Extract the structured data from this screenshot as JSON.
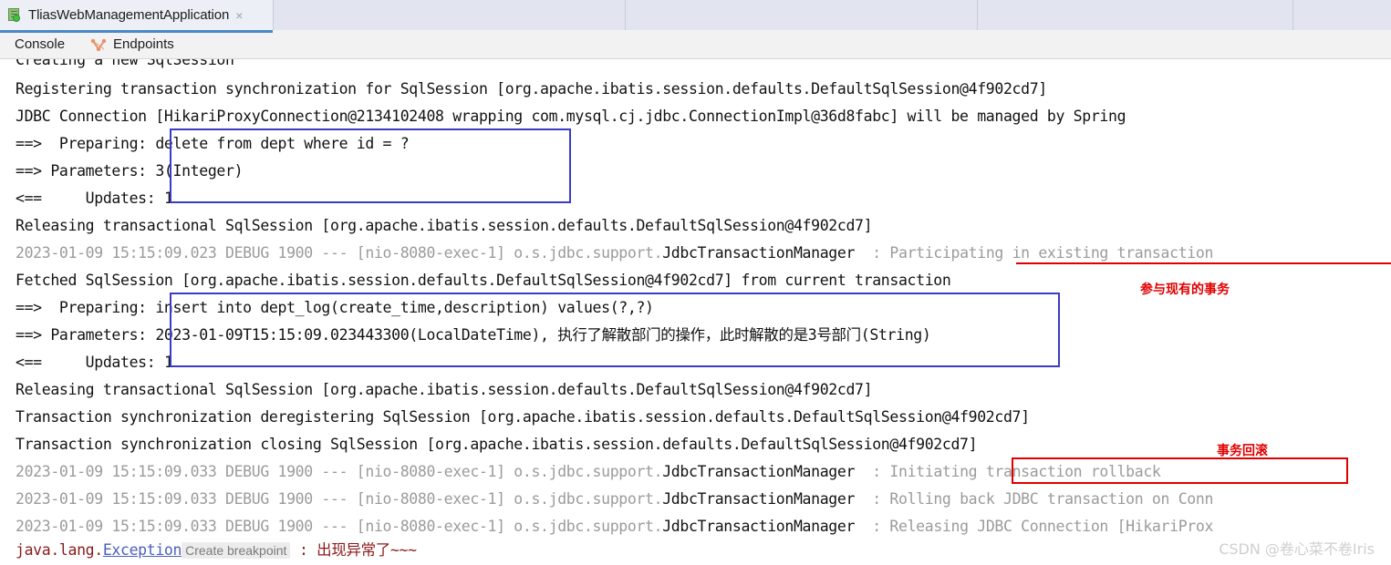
{
  "window": {
    "tab": {
      "icon": "run-configuration-icon",
      "title": "TliasWebManagementApplication",
      "close": "×"
    }
  },
  "console_bar": {
    "items": [
      {
        "label": "Console",
        "icon": "console-icon"
      },
      {
        "label": "Endpoints",
        "icon": "endpoints-icon"
      }
    ]
  },
  "console": {
    "clipped_line": "Creating a new SqlSession",
    "lines": [
      {
        "text": "Registering transaction synchronization for SqlSession [org.apache.ibatis.session.defaults.DefaultSqlSession@4f902cd7]",
        "style": "dark"
      },
      {
        "text": "JDBC Connection [HikariProxyConnection@2134102408 wrapping com.mysql.cj.jdbc.ConnectionImpl@36d8fabc] will be managed by Spring",
        "style": "dark"
      },
      {
        "text": "==>  Preparing: delete from dept where id = ?",
        "style": "dark"
      },
      {
        "text": "==> Parameters: 3(Integer)",
        "style": "dark"
      },
      {
        "text": "<==     Updates: 1",
        "style": "dark"
      },
      {
        "text": "Releasing transactional SqlSession [org.apache.ibatis.session.defaults.DefaultSqlSession@4f902cd7]",
        "style": "dark"
      },
      {
        "text": "2023-01-09 15:15:09.023 DEBUG 1900 --- [nio-8080-exec-1] o.s.jdbc.support.JdbcTransactionManager  : Participating in existing transaction",
        "style": "log"
      },
      {
        "text": "Fetched SqlSession [org.apache.ibatis.session.defaults.DefaultSqlSession@4f902cd7] from current transaction",
        "style": "dark"
      },
      {
        "text": "==>  Preparing: insert into dept_log(create_time,description) values(?,?)",
        "style": "dark"
      },
      {
        "text": "==> Parameters: 2023-01-09T15:15:09.023443300(LocalDateTime), 执行了解散部门的操作，此时解散的是3号部门(String)",
        "style": "dark"
      },
      {
        "text": "<==     Updates: 1",
        "style": "dark"
      },
      {
        "text": "Releasing transactional SqlSession [org.apache.ibatis.session.defaults.DefaultSqlSession@4f902cd7]",
        "style": "dark"
      },
      {
        "text": "Transaction synchronization deregistering SqlSession [org.apache.ibatis.session.defaults.DefaultSqlSession@4f902cd7]",
        "style": "dark"
      },
      {
        "text": "Transaction synchronization closing SqlSession [org.apache.ibatis.session.defaults.DefaultSqlSession@4f902cd7]",
        "style": "dark"
      },
      {
        "text": "2023-01-09 15:15:09.033 DEBUG 1900 --- [nio-8080-exec-1] o.s.jdbc.support.JdbcTransactionManager  : Initiating transaction rollback",
        "style": "log"
      },
      {
        "text": "2023-01-09 15:15:09.033 DEBUG 1900 --- [nio-8080-exec-1] o.s.jdbc.support.JdbcTransactionManager  : Rolling back JDBC transaction on Conn",
        "style": "log"
      },
      {
        "text": "2023-01-09 15:15:09.033 DEBUG 1900 --- [nio-8080-exec-1] o.s.jdbc.support.JdbcTransactionManager  : Releasing JDBC Connection [HikariProx",
        "style": "log"
      }
    ],
    "log_rows": {
      "row_participating": {
        "prefix": "2023-01-09 15:15:09.023 DEBUG 1900 --- [nio-8080-exec-1] o.s.jdbc.support.",
        "logger": "JdbcTransactionManager",
        "sep": "  : ",
        "message": "Participating in existing transaction"
      },
      "row_initiating": {
        "prefix": "2023-01-09 15:15:09.033 DEBUG 1900 --- [nio-8080-exec-1] o.s.jdbc.support.",
        "logger": "JdbcTransactionManager",
        "sep": "  : ",
        "message": "Initiating transaction rollback"
      },
      "row_rolling": {
        "prefix": "2023-01-09 15:15:09.033 DEBUG 1900 --- [nio-8080-exec-1] o.s.jdbc.support.",
        "logger": "JdbcTransactionManager",
        "sep": "  : ",
        "message": "Rolling back JDBC transaction on Conn"
      },
      "row_releasing": {
        "prefix": "2023-01-09 15:15:09.033 DEBUG 1900 --- [nio-8080-exec-1] o.s.jdbc.support.",
        "logger": "JdbcTransactionManager",
        "sep": "  : ",
        "message": "Releasing JDBC Connection [HikariProx"
      }
    },
    "sql_block_1": {
      "preparing_label": "==>  Preparing: ",
      "preparing_value": "delete from dept where id = ?",
      "parameters_label": "==> Parameters: ",
      "parameters_value": "3(Integer)",
      "updates_label": "<==     Updates: ",
      "updates_value": "1"
    },
    "sql_block_2": {
      "preparing_label": "==>  Preparing: ",
      "preparing_value": "insert into dept_log(create_time,description) values(?,?)",
      "parameters_label": "==> Parameters: ",
      "parameters_value": "2023-01-09T15:15:09.023443300(LocalDateTime), 执行了解散部门的操作，此时解散的是3号部门(String)",
      "updates_label": "<==     Updates: ",
      "updates_value": "1"
    },
    "plain_lines": {
      "registering": "Registering transaction synchronization for SqlSession [org.apache.ibatis.session.defaults.DefaultSqlSession@4f902cd7]",
      "jdbc_connection": "JDBC Connection [HikariProxyConnection@2134102408 wrapping com.mysql.cj.jdbc.ConnectionImpl@36d8fabc] will be managed by Spring",
      "releasing_1": "Releasing transactional SqlSession [org.apache.ibatis.session.defaults.DefaultSqlSession@4f902cd7]",
      "fetched": "Fetched SqlSession [org.apache.ibatis.session.defaults.DefaultSqlSession@4f902cd7] from current transaction",
      "releasing_2": "Releasing transactional SqlSession [org.apache.ibatis.session.defaults.DefaultSqlSession@4f902cd7]",
      "deregistering": "Transaction synchronization deregistering SqlSession [org.apache.ibatis.session.defaults.DefaultSqlSession@4f902cd7]",
      "closing": "Transaction synchronization closing SqlSession [org.apache.ibatis.session.defaults.DefaultSqlSession@4f902cd7]"
    },
    "exception": {
      "package": "java.lang.",
      "class": "Exception",
      "breakpoint": "Create breakpoint",
      "sep": " : ",
      "message": "出现异常了~~~"
    }
  },
  "annotations": {
    "participating": "参与现有的事务",
    "rollback": "事务回滚"
  },
  "watermark": "CSDN @卷心菜不卷Iris",
  "colors": {
    "blue_box": "#3b3bc4",
    "red_annotation": "#e00000",
    "log_gray": "#9b9b9b",
    "exception_red": "#8b1a1a",
    "tab_underline": "#4a88c7"
  }
}
